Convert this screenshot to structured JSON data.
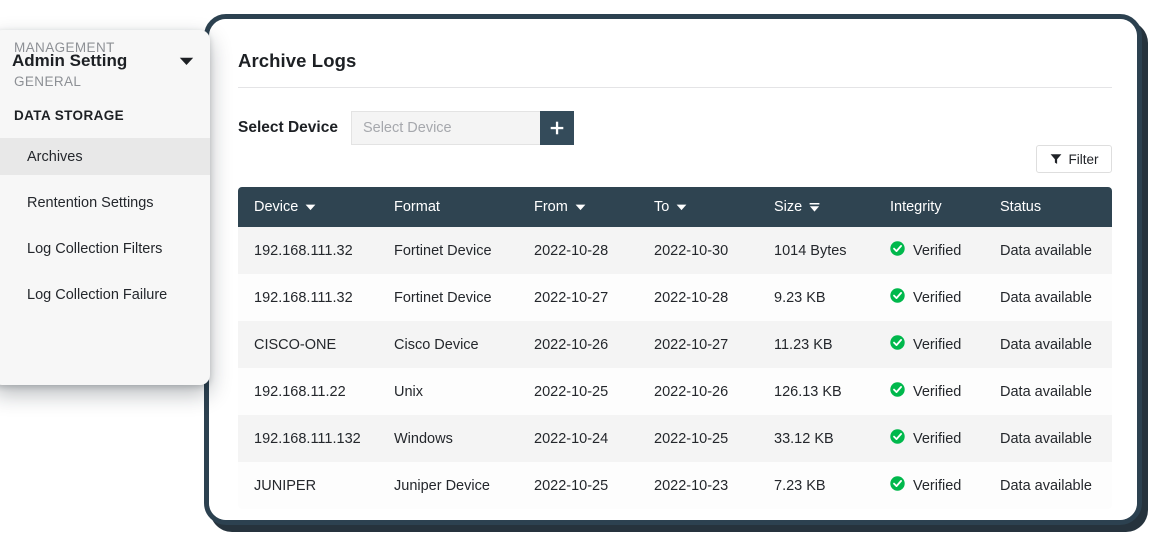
{
  "sidebar": {
    "title": "Admin Setting",
    "caret_icon": "chevron-down-icon",
    "sections": [
      {
        "label": "MANAGEMENT",
        "active": false
      },
      {
        "label": "GENERAL",
        "active": false
      },
      {
        "label": "DATA STORAGE",
        "active": true
      }
    ],
    "items": [
      {
        "label": "Archives",
        "selected": true
      },
      {
        "label": "Rentention Settings",
        "selected": false
      },
      {
        "label": "Log Collection Filters",
        "selected": false
      },
      {
        "label": "Log Collection Failure",
        "selected": false
      }
    ],
    "accent_color": "#4cbb5c",
    "selected_bg": "#e8e8e8"
  },
  "main": {
    "title": "Archive Logs",
    "select_device": {
      "label": "Select Device",
      "value": "",
      "placeholder": "Select Device",
      "add_button_icon": "plus-icon",
      "add_button_color": "#344b5a"
    },
    "filter_button": {
      "label": "Filter",
      "icon": "funnel-icon"
    },
    "table": {
      "header_bg": "#2f4451",
      "columns": [
        {
          "label": "Device",
          "sortable": true,
          "sort_state": "none"
        },
        {
          "label": "Format",
          "sortable": false,
          "sort_state": "none"
        },
        {
          "label": "From",
          "sortable": true,
          "sort_state": "none"
        },
        {
          "label": "To",
          "sortable": true,
          "sort_state": "none"
        },
        {
          "label": "Size",
          "sortable": true,
          "sort_state": "desc"
        },
        {
          "label": "Integrity",
          "sortable": false,
          "sort_state": "none"
        },
        {
          "label": "Status",
          "sortable": false,
          "sort_state": "none"
        }
      ],
      "rows": [
        {
          "device": "192.168.111.32",
          "format": "Fortinet Device",
          "from": "2022-10-28",
          "to": "2022-10-30",
          "size": "1014 Bytes",
          "integrity": "Verified",
          "integrity_icon": "check-circle-icon",
          "status": "Data available"
        },
        {
          "device": "192.168.111.32",
          "format": "Fortinet Device",
          "from": "2022-10-27",
          "to": "2022-10-28",
          "size": "9.23 KB",
          "integrity": "Verified",
          "integrity_icon": "check-circle-icon",
          "status": "Data available"
        },
        {
          "device": "CISCO-ONE",
          "format": "Cisco Device",
          "from": "2022-10-26",
          "to": "2022-10-27",
          "size": "11.23 KB",
          "integrity": "Verified",
          "integrity_icon": "check-circle-icon",
          "status": "Data available"
        },
        {
          "device": "192.168.11.22",
          "format": "Unix",
          "from": "2022-10-25",
          "to": "2022-10-26",
          "size": "126.13 KB",
          "integrity": "Verified",
          "integrity_icon": "check-circle-icon",
          "status": "Data available"
        },
        {
          "device": "192.168.111.132",
          "format": "Windows",
          "from": "2022-10-24",
          "to": "2022-10-25",
          "size": "33.12 KB",
          "integrity": "Verified",
          "integrity_icon": "check-circle-icon",
          "status": "Data available"
        },
        {
          "device": "JUNIPER",
          "format": "Juniper Device",
          "from": "2022-10-25",
          "to": "2022-10-23",
          "size": "7.23 KB",
          "integrity": "Verified",
          "integrity_icon": "check-circle-icon",
          "status": "Data available"
        }
      ],
      "verified_color": "#00b84c"
    }
  }
}
